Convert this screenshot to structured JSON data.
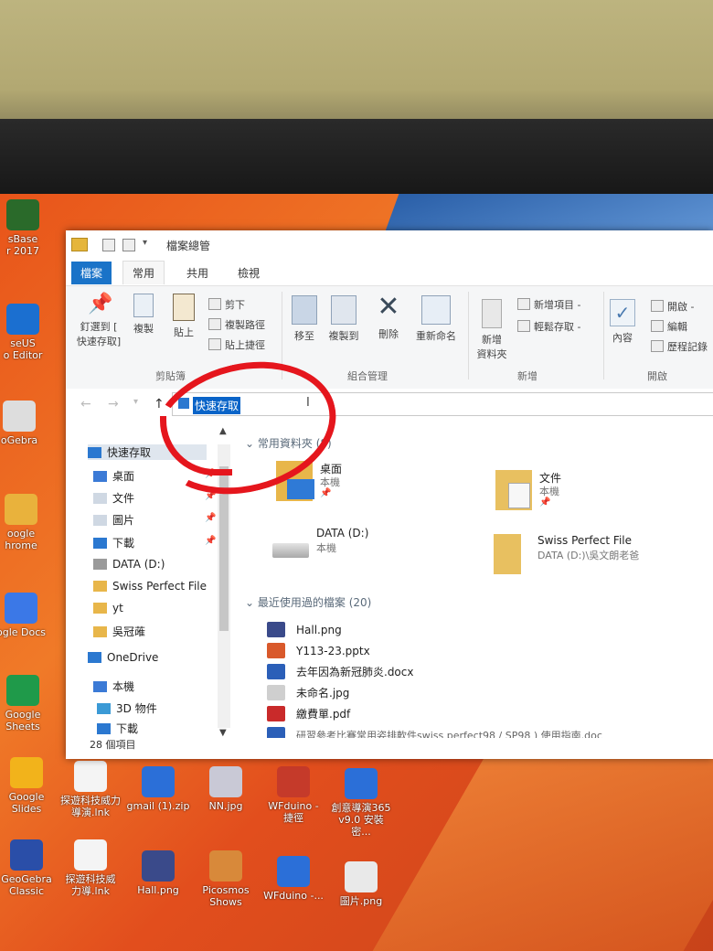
{
  "desktop_icons": [
    {
      "label": "sBase\nr 2017",
      "color": "#2a6a2a"
    },
    {
      "label": "seUS\no Editor",
      "color": "#1b6fd0"
    },
    {
      "label": "oGebra",
      "color": "#ddd"
    },
    {
      "label": "oogle\nhrome",
      "color": "#e9b23c"
    },
    {
      "label": "ogle Docs",
      "color": "#3b78e7"
    },
    {
      "label": "Google\nSheets",
      "color": "#1f9a4a"
    },
    {
      "label": "Google\nSlides",
      "color": "#f2b31b"
    },
    {
      "label": "探遊科技威力\n導演.lnk",
      "color": "#f4f4f4"
    },
    {
      "label": "gmail (1).zip",
      "color": "#2b6fd8"
    },
    {
      "label": "NN.jpg",
      "color": "#c9c9d6"
    },
    {
      "label": "WFduino -\n捷徑",
      "color": "#c53a2a"
    },
    {
      "label": "創意導演365\nv9.0 安裝密...",
      "color": "#2b6fd8"
    },
    {
      "label": "GeoGebra\nClassic",
      "color": "#2a4ea8"
    },
    {
      "label": "探遊科技威\n力導.lnk",
      "color": "#f4f4f4"
    },
    {
      "label": "Hall.png",
      "color": "#3a4a8a"
    },
    {
      "label": "Picosmos\nShows",
      "color": "#d8893a"
    },
    {
      "label": "WFduino -...",
      "color": "#2b6fd8"
    },
    {
      "label": "圖片.png",
      "color": "#e9e9e9"
    }
  ],
  "window": {
    "title": "檔案總管",
    "tabs": [
      "檔案",
      "常用",
      "共用",
      "檢視"
    ],
    "ribbon": {
      "clipboard": {
        "pin": "釘選到 [\n快速存取]",
        "copy": "複製",
        "paste": "貼上",
        "cut": "剪下",
        "copy_path": "複製路徑",
        "paste_shortcut": "貼上捷徑",
        "group": "剪貼簿"
      },
      "organize": {
        "move_to": "移至",
        "copy_to": "複製到",
        "delete": "刪除",
        "rename": "重新命名",
        "group": "組合管理"
      },
      "new": {
        "new_folder": "新增\n資料夾",
        "new_item": "新增項目 -",
        "easy_access": "輕鬆存取 -",
        "group": "新增"
      },
      "open": {
        "properties": "內容",
        "open": "開啟 -",
        "edit": "編輯",
        "history": "歷程記錄",
        "group": "開啟"
      }
    },
    "address": "快速存取",
    "nav": [
      {
        "label": "快速存取",
        "pinned": false
      },
      {
        "label": "桌面",
        "pinned": true
      },
      {
        "label": "文件",
        "pinned": true
      },
      {
        "label": "圖片",
        "pinned": true
      },
      {
        "label": "下載",
        "pinned": true
      },
      {
        "label": "DATA (D:)",
        "pinned": false
      },
      {
        "label": "Swiss Perfect File",
        "pinned": false
      },
      {
        "label": "yt",
        "pinned": false
      },
      {
        "label": "吳冠蓶",
        "pinned": false
      },
      {
        "label": "OneDrive",
        "pinned": false
      },
      {
        "label": "本機",
        "pinned": false
      },
      {
        "label": "3D 物件",
        "pinned": false
      },
      {
        "label": "下載",
        "pinned": false
      }
    ],
    "status": "28 個項目",
    "frequent_header": "常用資料夾 (8)",
    "frequent": [
      {
        "name": "桌面",
        "sub": "本機",
        "pin": "📌"
      },
      {
        "name": "文件",
        "sub": "本機",
        "pin": "📌"
      },
      {
        "name": "DATA (D:)",
        "sub": "本機",
        "pin": ""
      },
      {
        "name": "Swiss Perfect File",
        "sub": "DATA (D:)\\吳文朗老爸",
        "pin": ""
      }
    ],
    "recent_header": "最近使用過的檔案 (20)",
    "recent": [
      {
        "name": "Hall.png",
        "color": "#3a4a8a"
      },
      {
        "name": "Y113-23.pptx",
        "color": "#d9592b"
      },
      {
        "name": "去年因為新冠肺炎.docx",
        "color": "#2b5fb8"
      },
      {
        "name": "未命名.jpg",
        "color": "#cfcfcf"
      },
      {
        "name": "繳費單.pdf",
        "color": "#c92a2a"
      },
      {
        "name": "研習參考比賽常用姿排軟件swiss perfect98 / SP98 ) 使用指南.doc",
        "color": "#2b5fb8"
      }
    ]
  }
}
